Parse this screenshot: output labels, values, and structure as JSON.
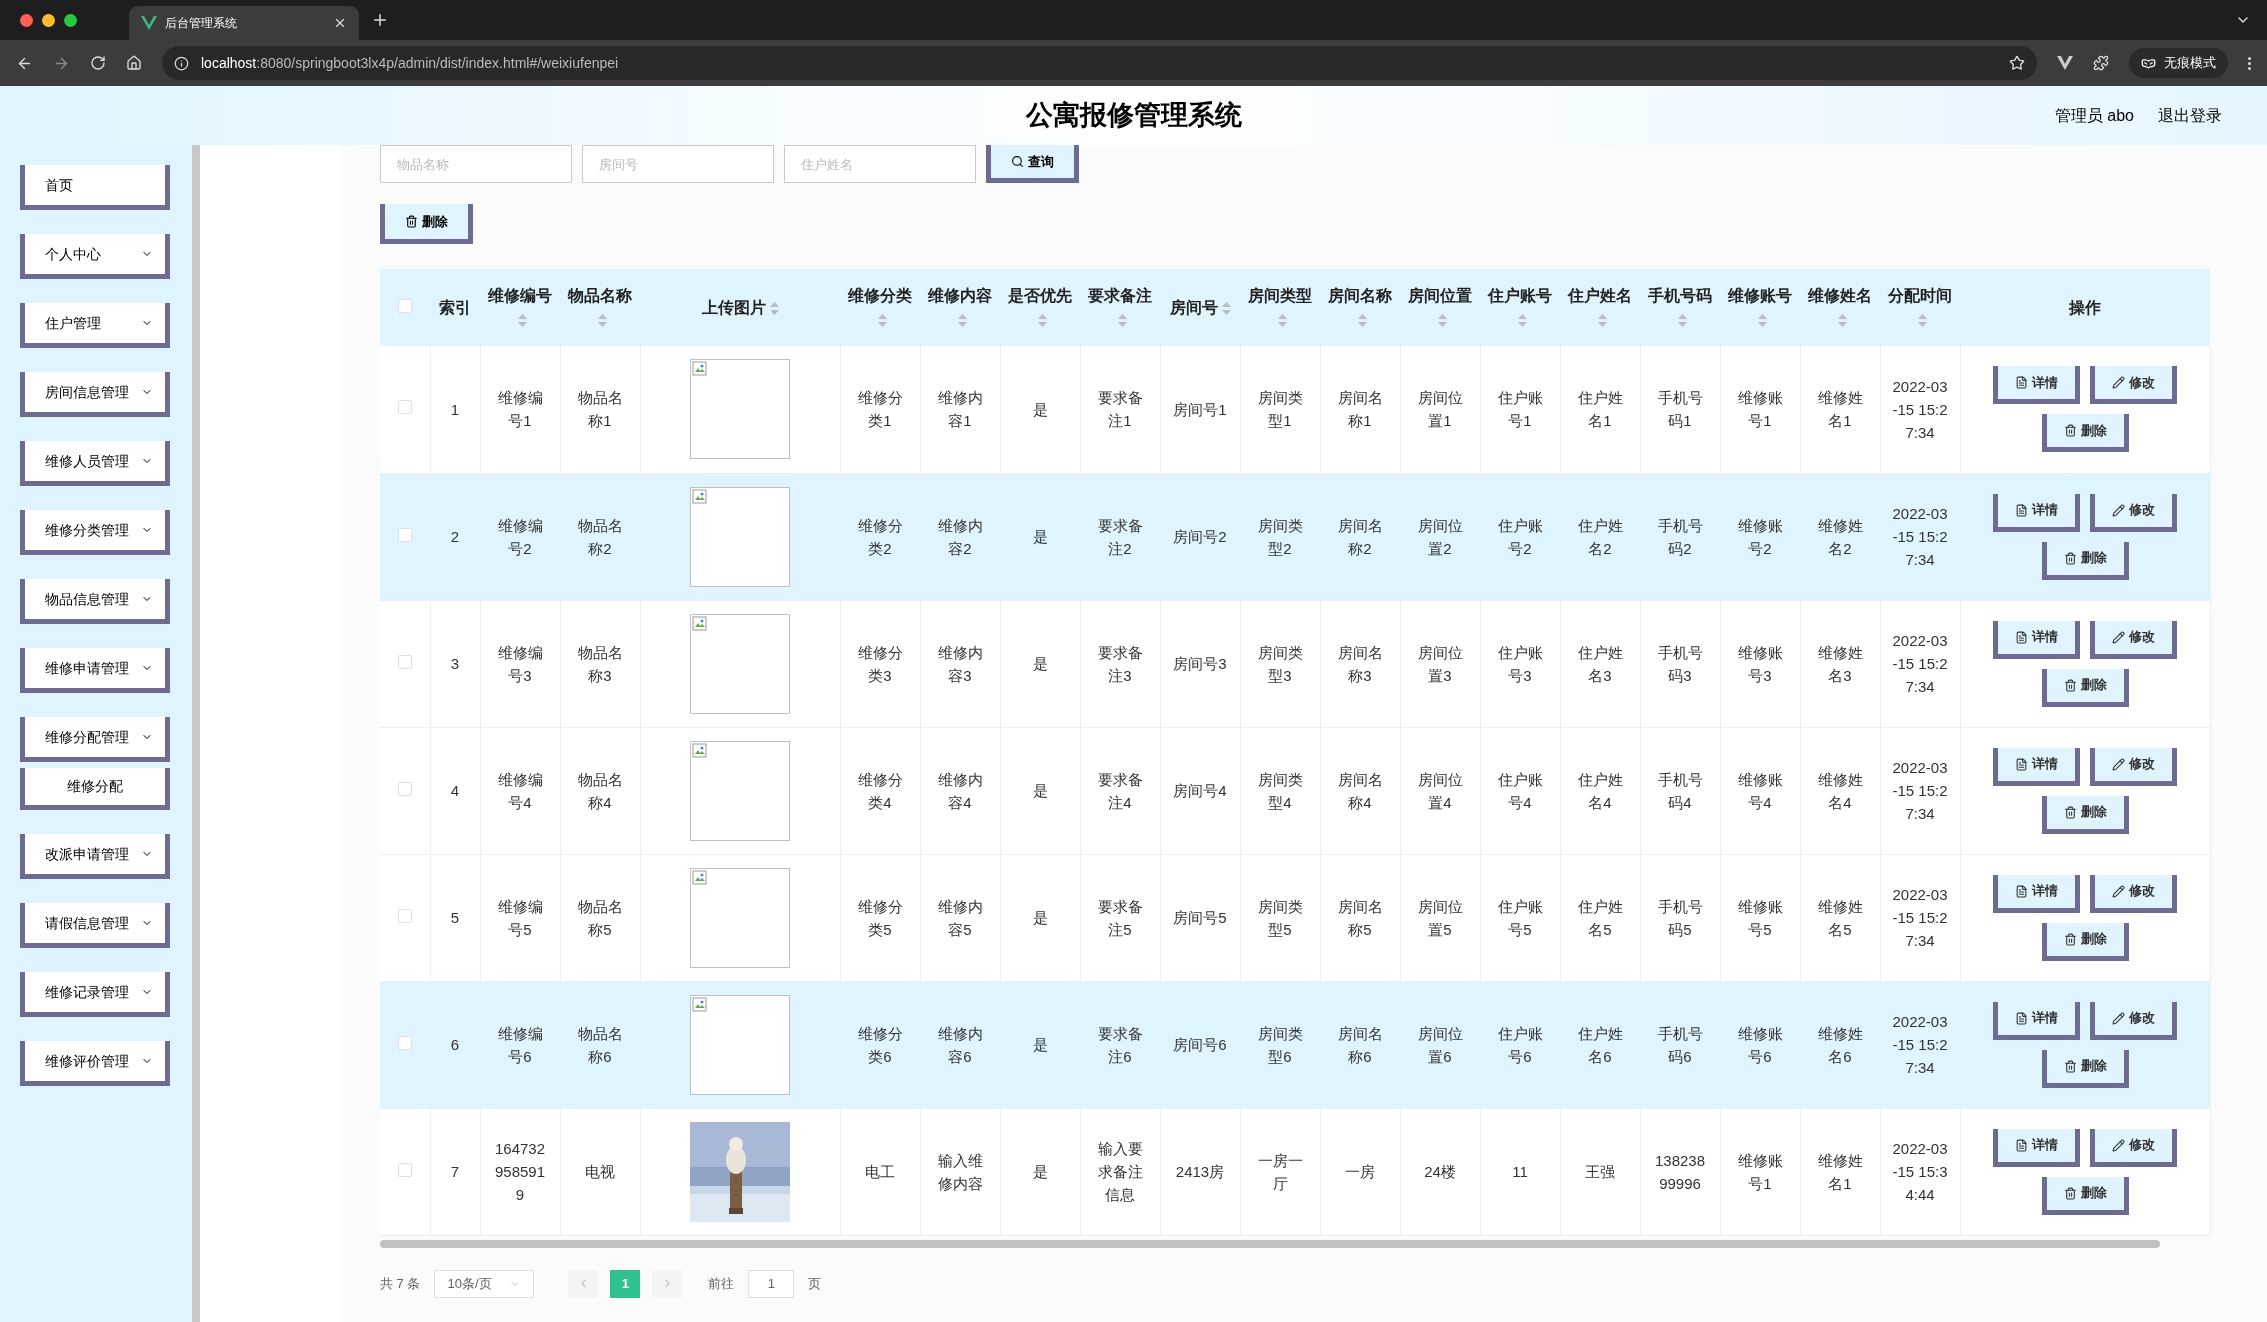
{
  "browser": {
    "tab_title": "后台管理系统",
    "url_host": "localhost",
    "url_rest": ":8080/springboot3lx4p/admin/dist/index.html#/weixiufenpei",
    "incognito": "无痕模式"
  },
  "header": {
    "title": "公寓报修管理系统",
    "user": "管理员 abo",
    "logout": "退出登录"
  },
  "sidebar": {
    "items": [
      {
        "label": "首页",
        "kind": "link"
      },
      {
        "label": "个人中心",
        "kind": "submenu"
      },
      {
        "label": "住户管理",
        "kind": "submenu"
      },
      {
        "label": "房间信息管理",
        "kind": "submenu"
      },
      {
        "label": "维修人员管理",
        "kind": "submenu"
      },
      {
        "label": "维修分类管理",
        "kind": "submenu"
      },
      {
        "label": "物品信息管理",
        "kind": "submenu"
      },
      {
        "label": "维修申请管理",
        "kind": "submenu"
      },
      {
        "label": "维修分配管理",
        "kind": "submenu",
        "children": [
          {
            "label": "维修分配"
          }
        ]
      },
      {
        "label": "改派申请管理",
        "kind": "submenu"
      },
      {
        "label": "请假信息管理",
        "kind": "submenu"
      },
      {
        "label": "维修记录管理",
        "kind": "submenu"
      },
      {
        "label": "维修评价管理",
        "kind": "submenu"
      }
    ]
  },
  "search": {
    "fields": [
      {
        "placeholder": "物品名称"
      },
      {
        "placeholder": "房间号"
      },
      {
        "placeholder": "住户姓名"
      }
    ],
    "button": "查询"
  },
  "toolbar": {
    "delete": "删除"
  },
  "table": {
    "header_checked": false,
    "columns": [
      {
        "kind": "checkbox"
      },
      {
        "kind": "text",
        "label": "索引",
        "sortable": false
      },
      {
        "kind": "text",
        "label": "维修编号",
        "sortable": true
      },
      {
        "kind": "text",
        "label": "物品名称",
        "sortable": true
      },
      {
        "label": "上传图片",
        "sortable": true
      },
      {
        "kind": "text",
        "label": "维修分类",
        "sortable": true
      },
      {
        "kind": "text",
        "label": "维修内容",
        "sortable": true
      },
      {
        "kind": "text",
        "label": "是否优先",
        "sortable": true
      },
      {
        "kind": "text",
        "label": "要求备注",
        "sortable": true
      },
      {
        "kind": "text",
        "label": "房间号",
        "sortable": true
      },
      {
        "kind": "text",
        "label": "房间类型",
        "sortable": true
      },
      {
        "kind": "text",
        "label": "房间名称",
        "sortable": true
      },
      {
        "kind": "text",
        "label": "房间位置",
        "sortable": true
      },
      {
        "kind": "text",
        "label": "住户账号",
        "sortable": true
      },
      {
        "kind": "text",
        "label": "住户姓名",
        "sortable": true
      },
      {
        "kind": "text",
        "label": "手机号码",
        "sortable": true
      },
      {
        "kind": "text",
        "label": "维修账号",
        "sortable": true
      },
      {
        "kind": "text",
        "label": "维修姓名",
        "sortable": true
      },
      {
        "kind": "text",
        "label": "分配时间",
        "sortable": true
      },
      {
        "kind": "actions",
        "label": "操作"
      }
    ],
    "rows": [
      {
        "checked": false,
        "selected": false,
        "image": {
          "kind": "broken"
        },
        "values": [
          "1",
          "维修编号1",
          "物品名称1",
          "维修分类1",
          "维修内容1",
          "是",
          "要求备注1",
          "房间号1",
          "房间类型1",
          "房间名称1",
          "房间位置1",
          "住户账号1",
          "住户姓名1",
          "手机号码1",
          "维修账号1",
          "维修姓名1",
          "2022-03-15 15:27:34"
        ],
        "buttons": [
          "详情",
          "修改",
          "删除"
        ]
      },
      {
        "checked": false,
        "selected": true,
        "image": {
          "kind": "broken"
        },
        "values": [
          "2",
          "维修编号2",
          "物品名称2",
          "维修分类2",
          "维修内容2",
          "是",
          "要求备注2",
          "房间号2",
          "房间类型2",
          "房间名称2",
          "房间位置2",
          "住户账号2",
          "住户姓名2",
          "手机号码2",
          "维修账号2",
          "维修姓名2",
          "2022-03-15 15:27:34"
        ],
        "buttons": [
          "详情",
          "修改",
          "删除"
        ]
      },
      {
        "checked": false,
        "selected": false,
        "image": {
          "kind": "broken"
        },
        "values": [
          "3",
          "维修编号3",
          "物品名称3",
          "维修分类3",
          "维修内容3",
          "是",
          "要求备注3",
          "房间号3",
          "房间类型3",
          "房间名称3",
          "房间位置3",
          "住户账号3",
          "住户姓名3",
          "手机号码3",
          "维修账号3",
          "维修姓名3",
          "2022-03-15 15:27:34"
        ],
        "buttons": [
          "详情",
          "修改",
          "删除"
        ]
      },
      {
        "checked": false,
        "selected": false,
        "image": {
          "kind": "broken"
        },
        "values": [
          "4",
          "维修编号4",
          "物品名称4",
          "维修分类4",
          "维修内容4",
          "是",
          "要求备注4",
          "房间号4",
          "房间类型4",
          "房间名称4",
          "房间位置4",
          "住户账号4",
          "住户姓名4",
          "手机号码4",
          "维修账号4",
          "维修姓名4",
          "2022-03-15 15:27:34"
        ],
        "buttons": [
          "详情",
          "修改",
          "删除"
        ]
      },
      {
        "checked": false,
        "selected": false,
        "image": {
          "kind": "broken"
        },
        "values": [
          "5",
          "维修编号5",
          "物品名称5",
          "维修分类5",
          "维修内容5",
          "是",
          "要求备注5",
          "房间号5",
          "房间类型5",
          "房间名称5",
          "房间位置5",
          "住户账号5",
          "住户姓名5",
          "手机号码5",
          "维修账号5",
          "维修姓名5",
          "2022-03-15 15:27:34"
        ],
        "buttons": [
          "详情",
          "修改",
          "删除"
        ]
      },
      {
        "checked": false,
        "selected": true,
        "image": {
          "kind": "broken"
        },
        "values": [
          "6",
          "维修编号6",
          "物品名称6",
          "维修分类6",
          "维修内容6",
          "是",
          "要求备注6",
          "房间号6",
          "房间类型6",
          "房间名称6",
          "房间位置6",
          "住户账号6",
          "住户姓名6",
          "手机号码6",
          "维修账号6",
          "维修姓名6",
          "2022-03-15 15:27:34"
        ],
        "buttons": [
          "详情",
          "修改",
          "删除"
        ]
      },
      {
        "checked": false,
        "selected": false,
        "values": [
          "7",
          "1647329585919",
          "电视",
          "电工",
          "输入维修内容",
          "是",
          "输入要求备注信息",
          "2413房",
          "一房一厅",
          "一房",
          "24楼",
          "11",
          "王强",
          "13823899996",
          "维修账号1",
          "维修姓名1",
          "2022-03-15 15:34:44"
        ],
        "buttons": [
          "详情",
          "修改",
          "删除"
        ]
      }
    ]
  },
  "pagination": {
    "total": "共 7 条",
    "page_size": "10条/页",
    "pages": [
      {
        "label": "1",
        "selected": true
      }
    ],
    "goto_label": "前往",
    "goto_value": "1",
    "goto_suffix": "页"
  }
}
